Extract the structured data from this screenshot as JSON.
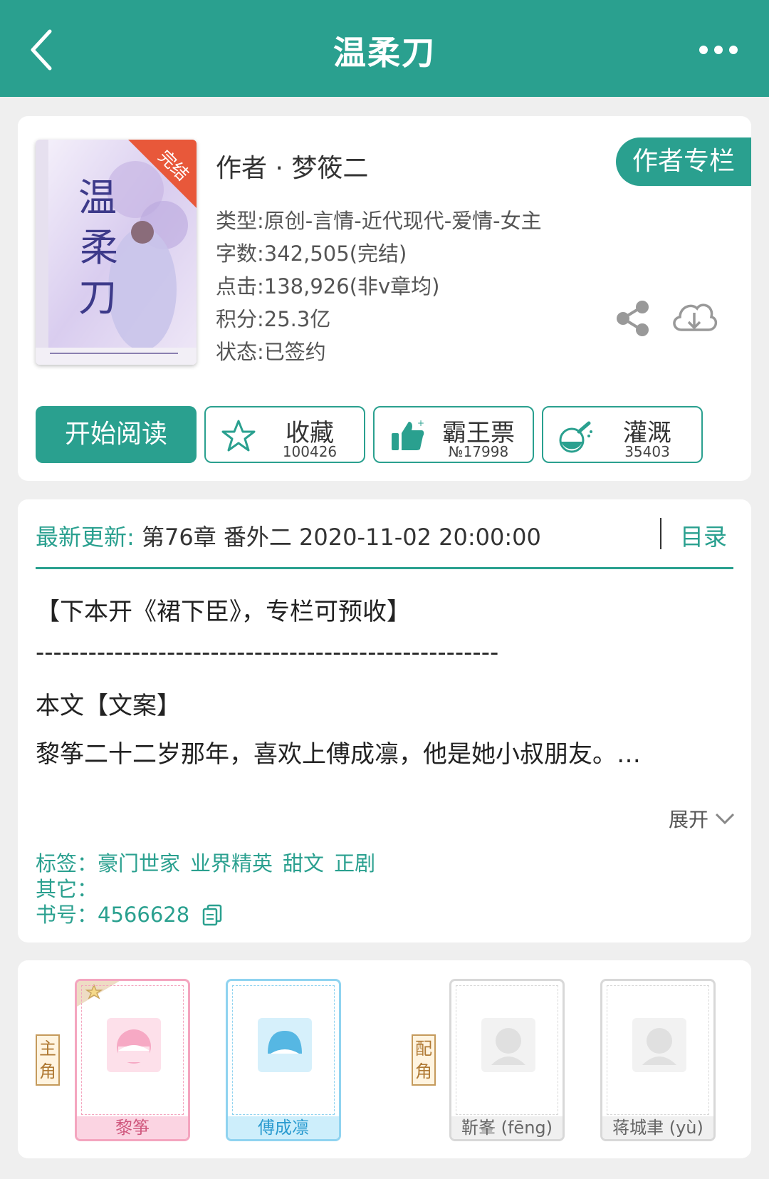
{
  "header": {
    "title": "温柔刀"
  },
  "book": {
    "cover_title": "温柔刀",
    "cover_badge": "完结",
    "author_line": "作者 · 梦筱二",
    "author_button": "作者专栏",
    "type": "类型:原创-言情-近代现代-爱情-女主",
    "words": "字数:342,505(完结)",
    "clicks": "点击:138,926(非v章均)",
    "score": "积分:25.3亿",
    "status": "状态:已签约"
  },
  "actions": {
    "read": "开始阅读",
    "collect": {
      "label": "收藏",
      "count": "100426"
    },
    "vote": {
      "label": "霸王票",
      "count": "№17998"
    },
    "water": {
      "label": "灌溉",
      "count": "35403"
    }
  },
  "update": {
    "prefix": "最新更新:",
    "text": " 第76章 番外二 2020-11-02 20:00:00",
    "toc": "目录"
  },
  "description": {
    "line1": "【下本开《裙下臣》，专栏可预收】",
    "line2": "-----------------------------------------------------",
    "line3": "本文【文案】",
    "line4": "黎筝二十二岁那年，喜欢上傅成凛，他是她小叔朋友。…",
    "expand": "展开"
  },
  "info": {
    "tags_label": "标签：",
    "tags": [
      "豪门世家",
      "业界精英",
      "甜文",
      "正剧"
    ],
    "other_label": "其它：",
    "bookno_label": "书号：",
    "bookno": "4566628"
  },
  "characters": {
    "main_tag": "主角",
    "support_tag": "配角",
    "list": [
      {
        "name": "黎筝"
      },
      {
        "name": "傅成凛"
      },
      {
        "name": "靳峯 (fēng)"
      },
      {
        "name": "蒋城聿 (yù)"
      }
    ]
  },
  "colors": {
    "accent": "#2aa08f",
    "pink": "#f4a5bf",
    "blue": "#8fd3f0"
  }
}
